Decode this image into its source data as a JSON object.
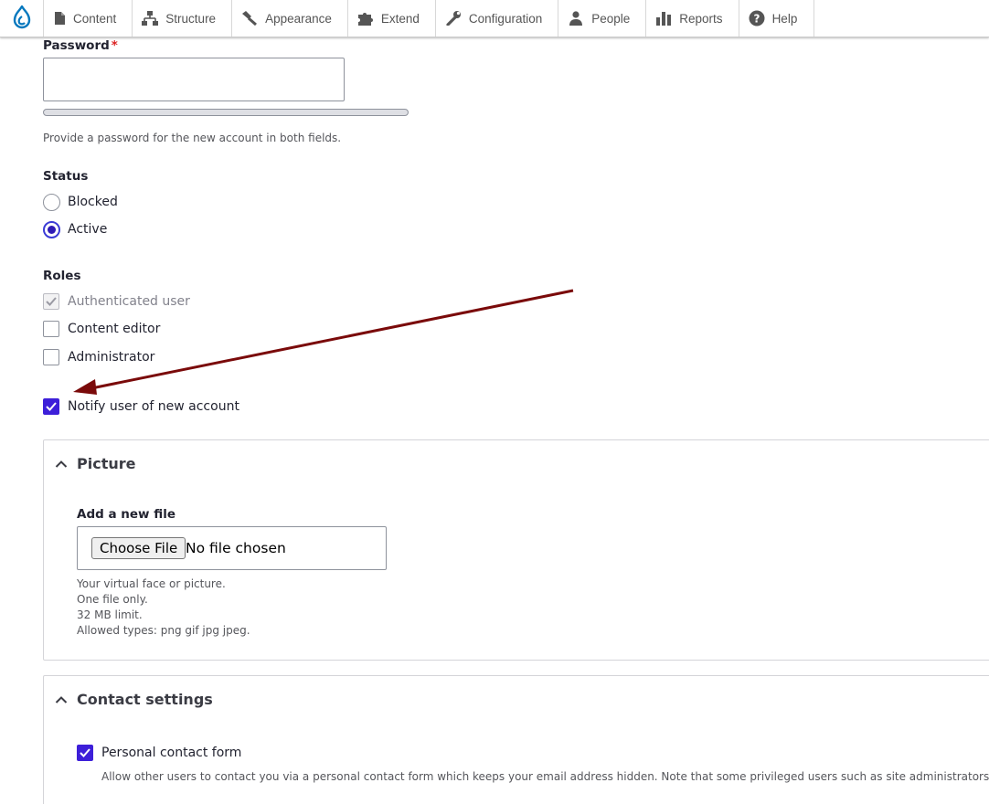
{
  "toolbar": {
    "items": [
      {
        "label": "Content",
        "icon": "content-icon"
      },
      {
        "label": "Structure",
        "icon": "structure-icon"
      },
      {
        "label": "Appearance",
        "icon": "appearance-icon"
      },
      {
        "label": "Extend",
        "icon": "extend-icon"
      },
      {
        "label": "Configuration",
        "icon": "configuration-icon"
      },
      {
        "label": "People",
        "icon": "people-icon"
      },
      {
        "label": "Reports",
        "icon": "reports-icon"
      },
      {
        "label": "Help",
        "icon": "help-icon"
      }
    ],
    "logo_icon": "drupal-logo-icon"
  },
  "password": {
    "label": "Password",
    "required_mark": "*",
    "value": "",
    "description": "Provide a password for the new account in both fields."
  },
  "status": {
    "label": "Status",
    "options": [
      {
        "label": "Blocked",
        "checked": false
      },
      {
        "label": "Active",
        "checked": true
      }
    ]
  },
  "roles": {
    "label": "Roles",
    "options": [
      {
        "label": "Authenticated user",
        "checked": true,
        "disabled": true
      },
      {
        "label": "Content editor",
        "checked": false
      },
      {
        "label": "Administrator",
        "checked": false
      }
    ]
  },
  "notify": {
    "label": "Notify user of new account",
    "checked": true
  },
  "picture": {
    "title": "Picture",
    "field_label": "Add a new file",
    "button_label": "Choose File",
    "file_status": "No file chosen",
    "descriptions": [
      "Your virtual face or picture.",
      "One file only.",
      "32 MB limit.",
      "Allowed types: png gif jpg jpeg."
    ]
  },
  "contact": {
    "title": "Contact settings",
    "option_label": "Personal contact form",
    "checked": true,
    "description": "Allow other users to contact you via a personal contact form which keeps your email address hidden. Note that some privileged users such as site administrators are still ab"
  },
  "colors": {
    "accent": "#3d1fd9",
    "required": "#dc2323",
    "annotation_arrow": "#7a0a0a",
    "drupal_blue": "#0678be"
  }
}
